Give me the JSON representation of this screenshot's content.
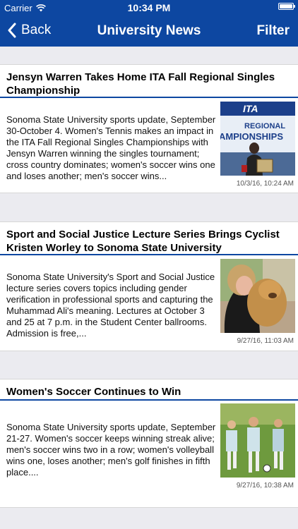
{
  "status": {
    "carrier": "Carrier",
    "time": "10:34 PM",
    "battery_level": 1.0
  },
  "nav": {
    "back_label": "Back",
    "title": "University News",
    "filter_label": "Filter"
  },
  "articles": [
    {
      "title": "Jensyn Warren Takes Home ITA Fall Regional Singles Championship",
      "summary": "Sonoma State University sports update, September 30-October 4. Women's Tennis makes an impact in the ITA Fall Regional Singles Championships with Jensyn Warren winning the singles tournament; cross country dominates; women's soccer wins one and loses another; men's soccer wins...",
      "date": "10/3/16, 10:24 AM",
      "image_banner_top": "ITA",
      "image_banner_mid": "REGIONAL",
      "image_banner_bottom": "AMPIONSHIPS"
    },
    {
      "title": "Sport and Social Justice Lecture Series Brings Cyclist Kristen Worley to Sonoma State University",
      "summary": "Sonoma State University's Sport and Social Justice lecture series covers topics including gender verification in professional sports and capturing the Muhammad Ali's meaning. Lectures at October 3 and 25 at 7 p.m. in the Student Center ballrooms. Admission is free,...",
      "date": "9/27/16, 11:03 AM"
    },
    {
      "title": "Women's Soccer Continues to Win",
      "summary": "Sonoma State University sports update, September 21-27. Women's soccer keeps winning streak alive; men's soccer wins two in a row; women's volleyball wins one, loses another; men's golf finishes in fifth place....",
      "date": "9/27/16, 10:38 AM"
    }
  ],
  "colors": {
    "nav_blue": "#0d47a1",
    "background": "#ebebf0"
  }
}
